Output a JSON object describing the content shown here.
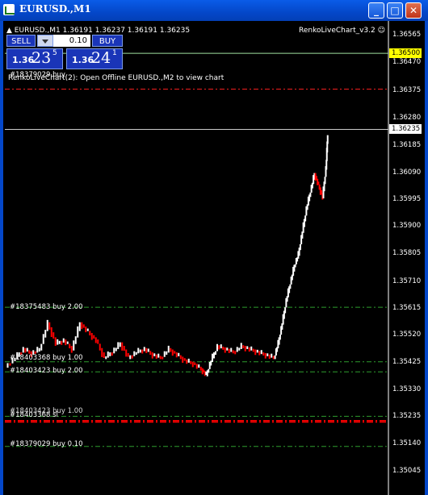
{
  "window": {
    "title": "EURUSD.,M1"
  },
  "header": {
    "info": "EURUSD.,M1  1.36191 1.36237 1.36191 1.36235",
    "indicator": "RenkoLiveChart_v3.2"
  },
  "trade_panel": {
    "sell_label": "SELL",
    "buy_label": "BUY",
    "lot": "0.10",
    "sell_price": {
      "big": "1.36",
      "mid": "23",
      "sup": "5"
    },
    "buy_price": {
      "big": "1.36",
      "mid": "24",
      "sup": "1"
    }
  },
  "message": "RenkoLiveChart(2): Open Offline EURUSD.,M2 to view chart",
  "order_labels": [
    {
      "text": "#18379029 buy",
      "top": 90
    },
    {
      "text": "#18375483 buy 2.00"
    },
    {
      "text": "#18403368 buy 1.00"
    },
    {
      "text": "#18403423 buy 2.00"
    },
    {
      "text": "#18403368 sl"
    },
    {
      "text": "#18403423 buy 1.00"
    },
    {
      "text": "#18379029 buy 0.10"
    }
  ],
  "price_axis": [
    "1.36565",
    "1.36470",
    "1.36375",
    "1.36280",
    "1.36185",
    "1.36090",
    "1.35995",
    "1.35900",
    "1.35805",
    "1.35710",
    "1.35615",
    "1.35520",
    "1.35425",
    "1.35330",
    "1.35235",
    "1.35140",
    "1.35045"
  ],
  "price_boxes": {
    "ask": "1.36500",
    "bid": "1.36235"
  },
  "colors": {
    "up": "#ffffff",
    "down": "#ff0000",
    "buy_line": "#2e9e2e",
    "sl_line": "#ff0000"
  },
  "chart_data": {
    "type": "line",
    "title": "",
    "ylim": [
      1.35,
      1.366
    ],
    "levels": {
      "buy_lines": [
        1.36375,
        1.35615,
        1.35425,
        1.3539,
        1.35235,
        1.3513
      ],
      "sl_lines": [
        1.35215,
        1.3522
      ],
      "bid": 1.36235,
      "ask": 1.365
    }
  }
}
